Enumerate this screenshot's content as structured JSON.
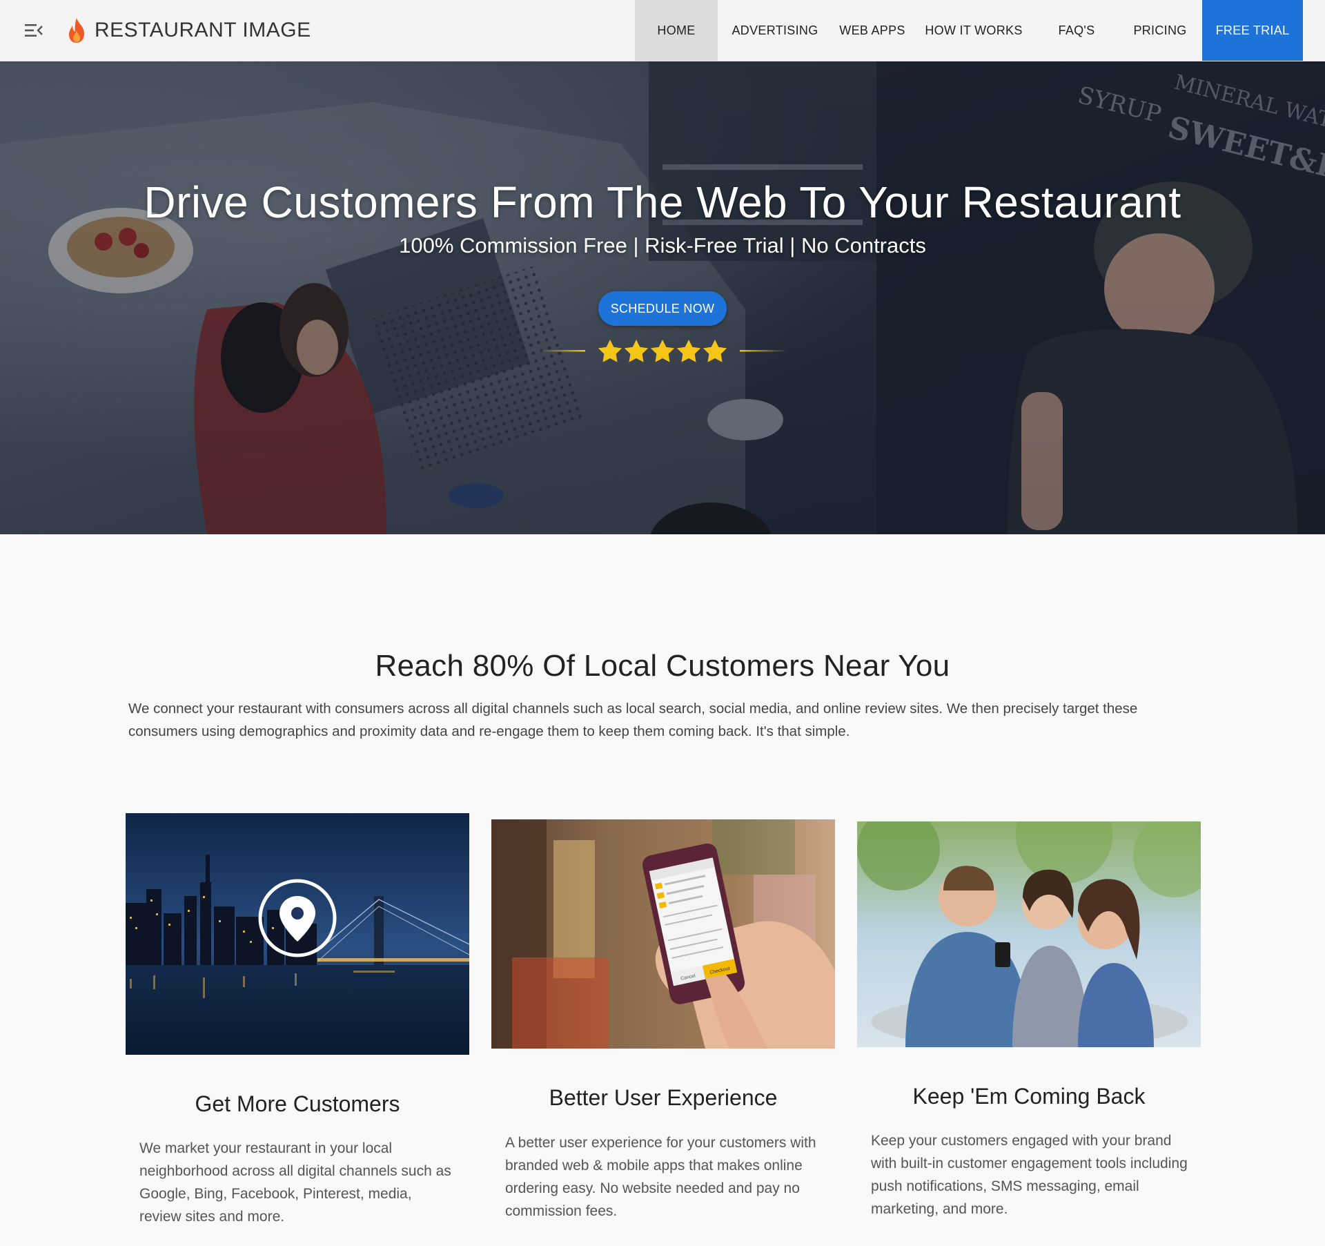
{
  "nav": {
    "brand": "RESTAURANT IMAGE",
    "links": {
      "home": "HOME",
      "advertising": "ADVERTISING",
      "web_apps": "WEB APPS",
      "how_it_works": "HOW IT WORKS",
      "faqs": "FAQ'S",
      "pricing": "PRICING",
      "free_trial": "FREE TRIAL"
    },
    "active": "HOME",
    "accent_color": "#1e73d8",
    "brand_icon": "flame-icon",
    "menu_icon": "menu-icon"
  },
  "hero": {
    "title": "Drive Customers From The Web To Your Restaurant",
    "subtitle": "100% Commission Free | Risk-Free Trial | No Contracts",
    "cta": "SCHEDULE NOW",
    "rating_stars": 5,
    "star_color": "#f5c518"
  },
  "intro": {
    "title": "Reach 80% Of Local Customers Near You",
    "text": "We connect your restaurant with consumers across all digital channels such as local search, social media, and online review sites. We then precisely target these consumers using demographics and proximity data and re-engage them to keep them coming back. It's that simple."
  },
  "features": [
    {
      "title": "Get More Customers",
      "text": "We market your restaurant in your local neighborhood across all digital channels such as Google, Bing, Facebook, Pinterest, media, review sites and more.",
      "image_icon": "map-pin-icon"
    },
    {
      "title": "Better User Experience",
      "text": "A better user experience for your customers with branded web & mobile apps that makes online ordering easy. No website needed and pay no commission fees.",
      "phone_buttons": {
        "cancel": "Cancel",
        "checkout": "Checkout"
      }
    },
    {
      "title": "Keep 'Em Coming Back",
      "text": "Keep your customers engaged with your brand with built-in customer engagement tools including push notifications, SMS messaging, email marketing, and more."
    }
  ]
}
